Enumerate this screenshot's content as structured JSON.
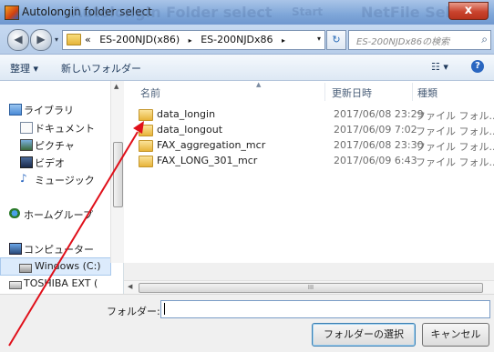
{
  "window": {
    "title": "Autolongin folder select",
    "ghost_title_1": "Autolongin Folder select",
    "ghost_title_2": "Start",
    "ghost_title_3": "NetFile Select",
    "close_label": "x"
  },
  "address_bar": {
    "prefix": "«",
    "crumbs": [
      "ES-200NJD(x86)",
      "ES-200NJDx86"
    ],
    "separator": "▸",
    "search_placeholder": "ES-200NJDx86の検索"
  },
  "toolbar": {
    "organize_label": "整理 ▾",
    "new_folder_label": "新しいフォルダー",
    "view_label": "☷ ▾",
    "help_label": "?"
  },
  "sidebar": {
    "items": [
      {
        "label": "ライブラリ",
        "icon": "library-icon"
      },
      {
        "label": "ドキュメント",
        "icon": "documents-icon"
      },
      {
        "label": "ピクチャ",
        "icon": "pictures-icon"
      },
      {
        "label": "ビデオ",
        "icon": "videos-icon"
      },
      {
        "label": "ミュージック",
        "icon": "music-icon"
      },
      {
        "label": "ホームグループ",
        "icon": "homegroup-icon"
      },
      {
        "label": "コンピューター",
        "icon": "computer-icon"
      },
      {
        "label": "Windows (C:)",
        "icon": "drive-icon"
      },
      {
        "label": "TOSHIBA EXT (",
        "icon": "external-drive-icon"
      }
    ]
  },
  "filelist": {
    "columns": {
      "name": "名前",
      "date": "更新日時",
      "type": "種類"
    },
    "rows": [
      {
        "name": "data_longin",
        "date": "2017/06/08 23:29",
        "type": "ファイル フォル..."
      },
      {
        "name": "data_longout",
        "date": "2017/06/09 7:02",
        "type": "ファイル フォル..."
      },
      {
        "name": "FAX_aggregation_mcr",
        "date": "2017/06/08 23:30",
        "type": "ファイル フォル..."
      },
      {
        "name": "FAX_LONG_301_mcr",
        "date": "2017/06/09 6:43",
        "type": "ファイル フォル..."
      }
    ]
  },
  "bottom": {
    "folder_label": "フォルダー:",
    "folder_value": "",
    "select_button": "フォルダーの選択",
    "cancel_button": "キャンセル"
  },
  "hscroll_grip": "III",
  "colors": {
    "annotation_arrow": "#e0101a",
    "titlebar": "#7ea6d8"
  }
}
